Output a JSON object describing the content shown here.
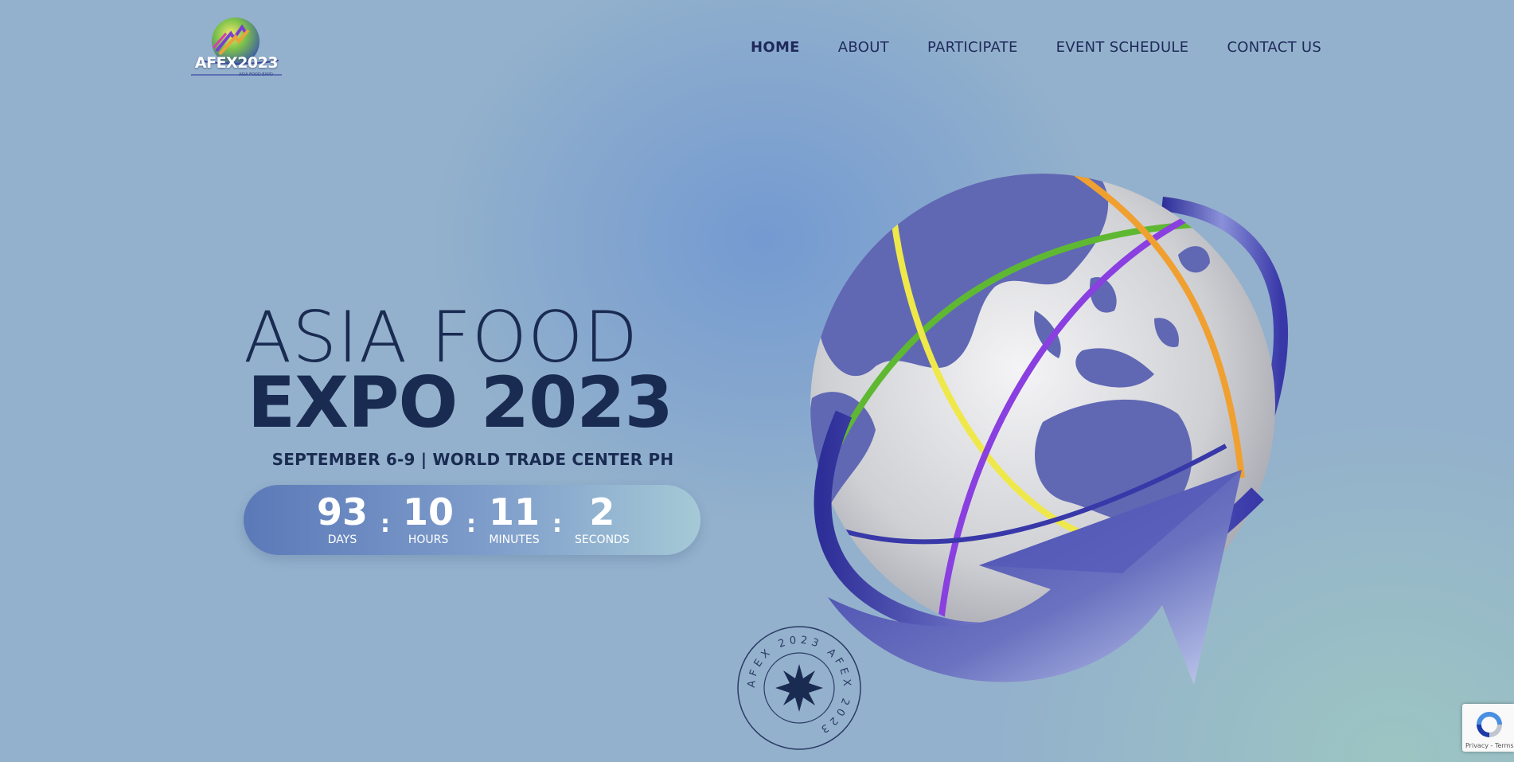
{
  "header": {
    "logo_text": "AFEX2023",
    "logo_sub": "ASIA FOOD EXPO",
    "nav": [
      {
        "label": "HOME"
      },
      {
        "label": "ABOUT"
      },
      {
        "label": "PARTICIPATE"
      },
      {
        "label": "EVENT SCHEDULE"
      },
      {
        "label": "CONTACT US"
      }
    ],
    "active_nav": "HOME"
  },
  "hero": {
    "title_line1": "ASIA FOOD",
    "title_line2": "EXPO 2023",
    "subtitle": "SEPTEMBER 6-9 | WORLD TRADE CENTER PH",
    "countdown": {
      "days": {
        "value": "93",
        "label": "DAYS"
      },
      "hours": {
        "value": "10",
        "label": "HOURS"
      },
      "minutes": {
        "value": "11",
        "label": "MINUTES"
      },
      "seconds": {
        "value": "2",
        "label": "SECONDS"
      },
      "separator": ":"
    }
  },
  "stamp": {
    "ring_text": "AFEX 2023   AFEX 2023"
  },
  "recaptcha": {
    "text": "Privacy - Terms",
    "icon": "recaptcha-icon"
  },
  "colors": {
    "background": "#93b1cc",
    "text_dark": "#1a2b52",
    "nav_text": "#1f2a5a",
    "countdown_start": "#5b79b8",
    "countdown_end": "#a6c9d6",
    "globe_land": "#6068b4",
    "arrow": "#4a4fb0",
    "ribbon_green": "#5fb832",
    "ribbon_yellow": "#efe84a",
    "ribbon_purple": "#8a3fe0",
    "ribbon_orange": "#f0a030"
  }
}
